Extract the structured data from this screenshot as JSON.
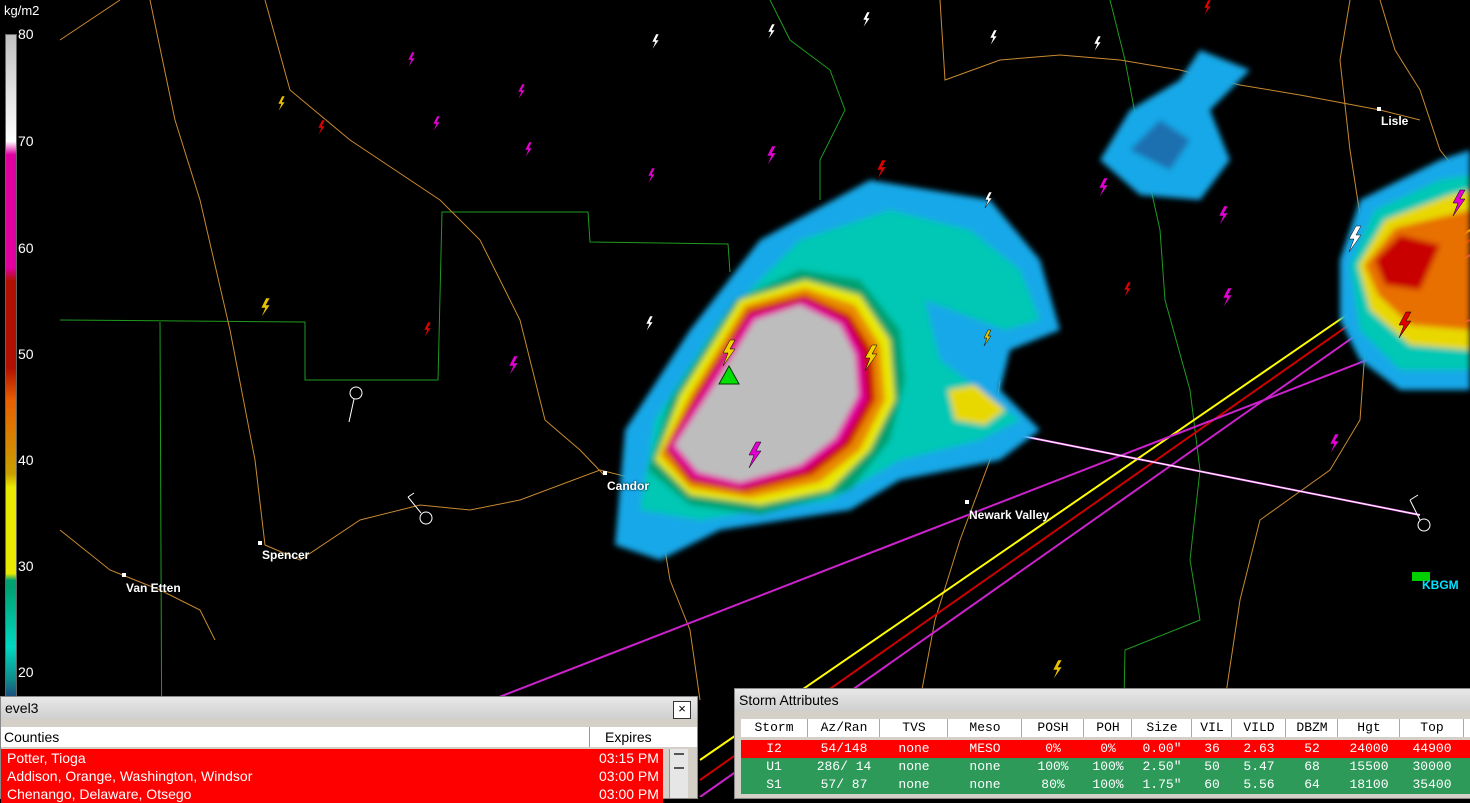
{
  "scale": {
    "unit": "kg/m2",
    "ticks": [
      "80",
      "70",
      "60",
      "50",
      "40",
      "30",
      "20"
    ],
    "colors": [
      "#1b3f7a",
      "#0f8a8a",
      "#00d8c0",
      "#00a070",
      "#e8e800",
      "#e8a000",
      "#e86000",
      "#b01000",
      "#e00090",
      "#ffffff",
      "#c0c0c0"
    ]
  },
  "cities": [
    {
      "name": "Lisle"
    },
    {
      "name": "Candor"
    },
    {
      "name": "Newark Valley"
    },
    {
      "name": "Spencer"
    },
    {
      "name": "Van Etten"
    }
  ],
  "radar_site": {
    "name": "KBGM",
    "color": "#00e0ff"
  },
  "warnings_panel": {
    "title": "evel3",
    "close_label": "×",
    "headers": {
      "counties": "Counties",
      "expires": "Expires"
    },
    "rows": [
      {
        "counties": "Potter, Tioga",
        "expires": "03:15 PM"
      },
      {
        "counties": "Addison, Orange, Washington, Windsor",
        "expires": "03:00 PM"
      },
      {
        "counties": "Chenango, Delaware, Otsego",
        "expires": "03:00 PM"
      }
    ],
    "row_color": "#ff0000"
  },
  "storm_panel": {
    "title": "Storm Attributes",
    "columns": [
      "Storm",
      "Az/Ran",
      "TVS",
      "Meso",
      "POSH",
      "POH",
      "Size",
      "VIL",
      "VILD",
      "DBZM",
      "Hgt",
      "Top"
    ],
    "rows": [
      {
        "color": "#ff0000",
        "cells": [
          "I2",
          "54/148",
          "none",
          "MESO",
          "0%",
          "0%",
          "0.00\"",
          "36",
          "2.63",
          "52",
          "24000",
          "44900"
        ]
      },
      {
        "color": "#2e9a5a",
        "cells": [
          "U1",
          "286/ 14",
          "none",
          "none",
          "100%",
          "100%",
          "2.50\"",
          "50",
          "5.47",
          "68",
          "15500",
          "30000"
        ]
      },
      {
        "color": "#2e9a5a",
        "cells": [
          "S1",
          "57/ 87",
          "none",
          "none",
          "80%",
          "100%",
          "1.75\"",
          "60",
          "5.56",
          "64",
          "18100",
          "35400"
        ]
      }
    ]
  }
}
